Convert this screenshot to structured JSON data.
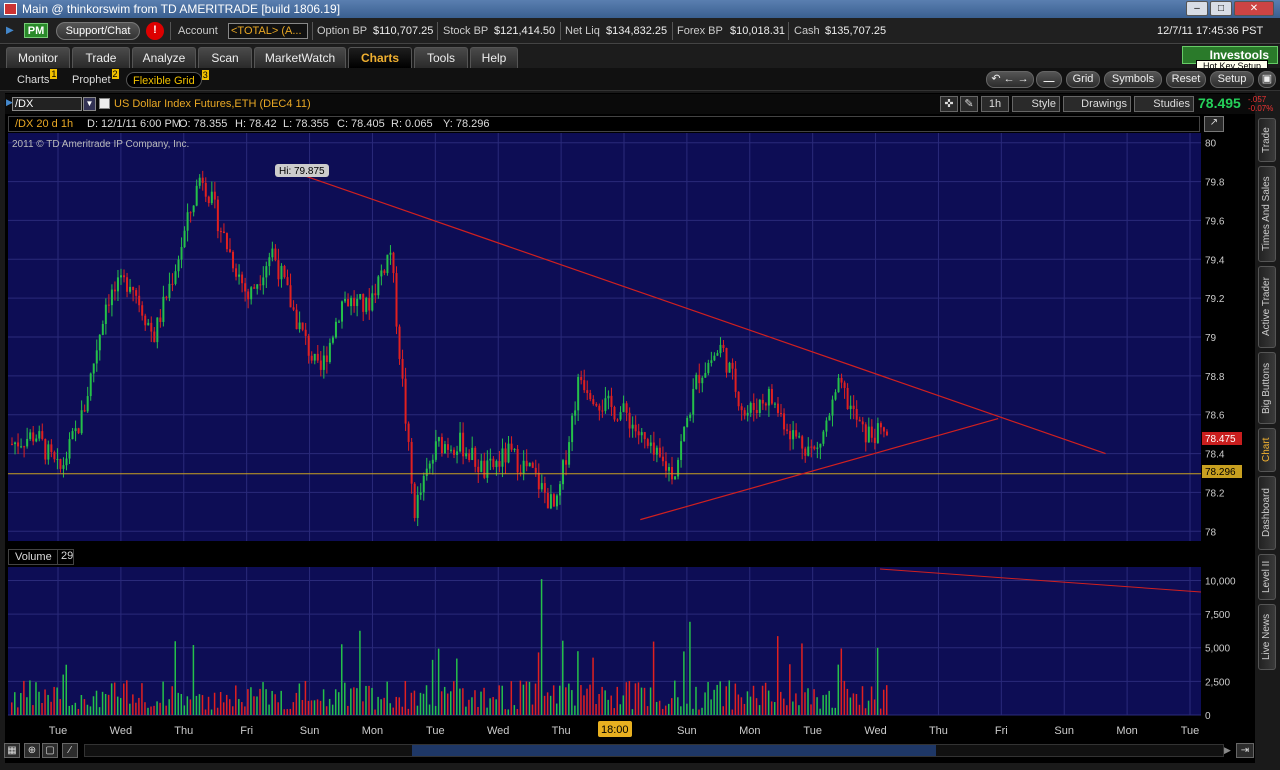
{
  "window": {
    "title": "Main @ thinkorswim from TD AMERITRADE [build 1806.19]",
    "min": "–",
    "max": "□",
    "close": "✕"
  },
  "account": {
    "pm_badge": "PM",
    "support_label": "Support/Chat",
    "alert_label": "!",
    "account_label": "Account",
    "account_value": "<TOTAL> (A...",
    "option_bp_label": "Option BP",
    "option_bp": "$110,707.25",
    "stock_bp_label": "Stock BP",
    "stock_bp": "$121,414.50",
    "net_liq_label": "Net Liq",
    "net_liq": "$134,832.25",
    "forex_bp_label": "Forex BP",
    "forex_bp": "$10,018.31",
    "cash_label": "Cash",
    "cash": "$135,707.25",
    "datetime": "12/7/11 17:45:36 PST"
  },
  "tabs": [
    "Monitor",
    "Trade",
    "Analyze",
    "Scan",
    "MarketWatch",
    "Charts",
    "Tools",
    "Help"
  ],
  "active_tab": "Charts",
  "investools": "Investools",
  "hotkey_tooltip": "Hot Key Setup",
  "subtabs": [
    {
      "label": "Charts",
      "num": "1"
    },
    {
      "label": "Prophet",
      "num": "2"
    },
    {
      "label": "Flexible Grid",
      "num": "3"
    }
  ],
  "toolbar": {
    "grid": "Grid",
    "symbols": "Symbols",
    "reset": "Reset",
    "setup": "Setup"
  },
  "chart_header": {
    "symbol": "/DX",
    "description": "US Dollar Index Futures,ETH (DEC4 11)",
    "interval": "1h",
    "style": "Style",
    "drawings": "Drawings",
    "studies": "Studies",
    "last_price": "78.495",
    "change": "-.057",
    "change_pct": "-0.07%"
  },
  "ohlc": {
    "label": "/DX 20 d 1h",
    "date": "D: 12/1/11 6:00 PM",
    "open": "O: 78.355",
    "high": "H: 78.42",
    "low": "L: 78.355",
    "close": "C: 78.405",
    "range": "R: 0.065",
    "y": "Y: 78.296"
  },
  "copyright": "2011 © TD Ameritrade IP Company, Inc.",
  "high_marker": "Hi: 79.875",
  "volume_header": {
    "label": "Volume",
    "value": "29"
  },
  "sidebar_tabs": [
    "Trade",
    "Times And Sales",
    "Active Trader",
    "Big Buttons",
    "Chart",
    "Dashboard",
    "Level II",
    "Live News"
  ],
  "active_sidebar": "Chart",
  "time_marker": "18:00",
  "colors": {
    "accent": "#e9a825",
    "up": "#25c04a",
    "down": "#e02020",
    "chart_bg": "#0d0d55",
    "trendline": "#d02020"
  },
  "chart_data": {
    "type": "candlestick",
    "symbol": "/DX",
    "price_axis": {
      "ticks": [
        "80",
        "79.8",
        "79.6",
        "79.4",
        "79.2",
        "79",
        "78.8",
        "78.6",
        "78.4",
        "78.2",
        "78"
      ],
      "range": [
        77.95,
        80.05
      ]
    },
    "price_labels": {
      "last": "78.475",
      "y_line": "78.296"
    },
    "volume_axis": {
      "ticks": [
        "10,000",
        "7,500",
        "5,000",
        "2,500",
        "0"
      ],
      "range": [
        0,
        11000
      ]
    },
    "x_labels": [
      "Tue",
      "Wed",
      "Thu",
      "Fri",
      "Sun",
      "Mon",
      "Tue",
      "Wed",
      "Thu",
      "Fri",
      "Sun",
      "Mon",
      "Tue",
      "Wed",
      "Thu",
      "Fri",
      "Sun",
      "Mon",
      "Tue"
    ],
    "high": 79.875,
    "horizontal_line": 78.296,
    "trendlines": [
      {
        "from": [
          0.225,
          79.88
        ],
        "to": [
          0.92,
          78.4
        ]
      },
      {
        "from": [
          0.53,
          78.06
        ],
        "to": [
          0.83,
          78.58
        ]
      }
    ],
    "price_path": [
      78.45,
      78.5,
      78.3,
      78.6,
      79.2,
      79.3,
      79.0,
      79.4,
      79.85,
      79.5,
      79.2,
      79.45,
      79.1,
      78.8,
      79.2,
      79.15,
      79.45,
      78.1,
      78.45,
      78.45,
      78.3,
      78.4,
      78.3,
      78.1,
      78.8,
      78.65,
      78.6,
      78.4,
      78.3,
      78.8,
      78.95,
      78.6,
      78.7,
      78.5,
      78.4,
      78.75,
      78.5,
      78.5
    ]
  }
}
